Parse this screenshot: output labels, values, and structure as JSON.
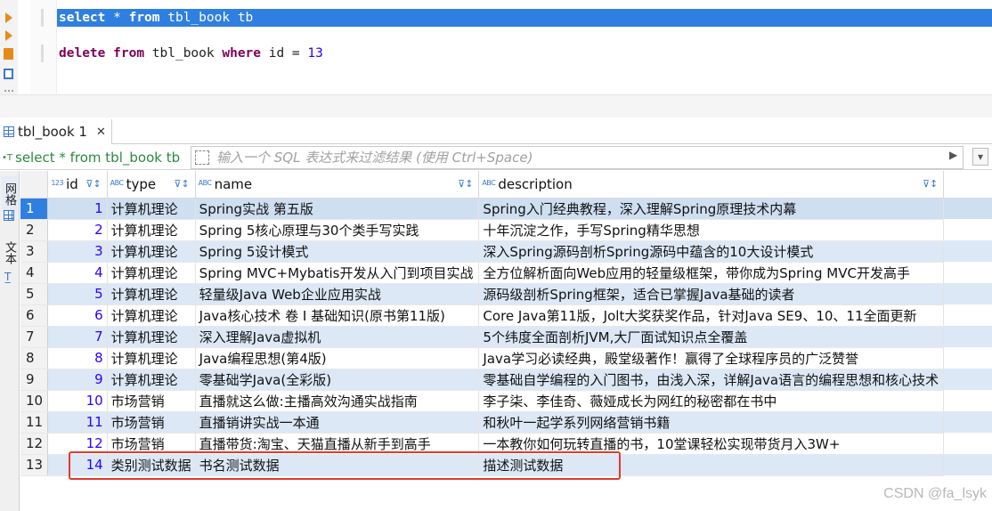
{
  "editor": {
    "line1": {
      "kw1": "select",
      "rest1": " * ",
      "kw2": "from",
      "rest2": " tbl_book tb"
    },
    "line2": {
      "kw1": "delete",
      "rest1": " ",
      "kw2": "from",
      "rest2": " tbl_book ",
      "kw3": "where",
      "rest3": " id = ",
      "num": "13"
    }
  },
  "result_tab": {
    "label": "tbl_book 1",
    "close": "✕"
  },
  "filter_bar": {
    "query": "select * from tbl_book tb",
    "placeholder": "输入一个 SQL 表达式来过滤结果 (使用 Ctrl+Space)"
  },
  "side_tabs": {
    "grid": "网格",
    "text": "文本"
  },
  "columns": [
    {
      "name": "id",
      "type_icon": "123"
    },
    {
      "name": "type",
      "type_icon": "ABC"
    },
    {
      "name": "name",
      "type_icon": "ABC"
    },
    {
      "name": "description",
      "type_icon": "ABC"
    }
  ],
  "rows": [
    {
      "n": "1",
      "id": "1",
      "type": "计算机理论",
      "name": "Spring实战 第五版",
      "description": "Spring入门经典教程，深入理解Spring原理技术内幕"
    },
    {
      "n": "2",
      "id": "2",
      "type": "计算机理论",
      "name": "Spring 5核心原理与30个类手写实践",
      "description": "十年沉淀之作，手写Spring精华思想"
    },
    {
      "n": "3",
      "id": "3",
      "type": "计算机理论",
      "name": "Spring 5设计模式",
      "description": "深入Spring源码剖析Spring源码中蕴含的10大设计模式"
    },
    {
      "n": "4",
      "id": "4",
      "type": "计算机理论",
      "name": "Spring MVC+Mybatis开发从入门到项目实战",
      "description": "全方位解析面向Web应用的轻量级框架，带你成为Spring MVC开发高手"
    },
    {
      "n": "5",
      "id": "5",
      "type": "计算机理论",
      "name": "轻量级Java Web企业应用实战",
      "description": "源码级剖析Spring框架，适合已掌握Java基础的读者"
    },
    {
      "n": "6",
      "id": "6",
      "type": "计算机理论",
      "name": "Java核心技术 卷 I 基础知识(原书第11版)",
      "description": "Core Java第11版，Jolt大奖获奖作品，针对Java SE9、10、11全面更新"
    },
    {
      "n": "7",
      "id": "7",
      "type": "计算机理论",
      "name": "深入理解Java虚拟机",
      "description": "5个纬度全面剖析JVM,大厂面试知识点全覆盖"
    },
    {
      "n": "8",
      "id": "8",
      "type": "计算机理论",
      "name": "Java编程思想(第4版)",
      "description": "Java学习必读经典，殿堂级著作！赢得了全球程序员的广泛赞誉"
    },
    {
      "n": "9",
      "id": "9",
      "type": "计算机理论",
      "name": "零基础学Java(全彩版)",
      "description": "零基础自学编程的入门图书，由浅入深，详解Java语言的编程思想和核心技术"
    },
    {
      "n": "10",
      "id": "10",
      "type": "市场营销",
      "name": "直播就这么做:主播高效沟通实战指南",
      "description": "李子柒、李佳奇、薇娅成长为网红的秘密都在书中"
    },
    {
      "n": "11",
      "id": "11",
      "type": "市场营销",
      "name": "直播销讲实战一本通",
      "description": "和秋叶一起学系列网络营销书籍"
    },
    {
      "n": "12",
      "id": "12",
      "type": "市场营销",
      "name": "直播带货:淘宝、天猫直播从新手到高手",
      "description": "一本教你如何玩转直播的书，10堂课轻松实现带货月入3W+"
    },
    {
      "n": "13",
      "id": "14",
      "type": "类别测试数据",
      "name": "书名测试数据",
      "description": "描述测试数据"
    }
  ],
  "watermark": "CSDN @fa_lsyk",
  "colors": {
    "selection": "#2f7fe0",
    "keyword": "#7f0055",
    "number": "#2a00ff",
    "highlight": "#e43a2f"
  }
}
